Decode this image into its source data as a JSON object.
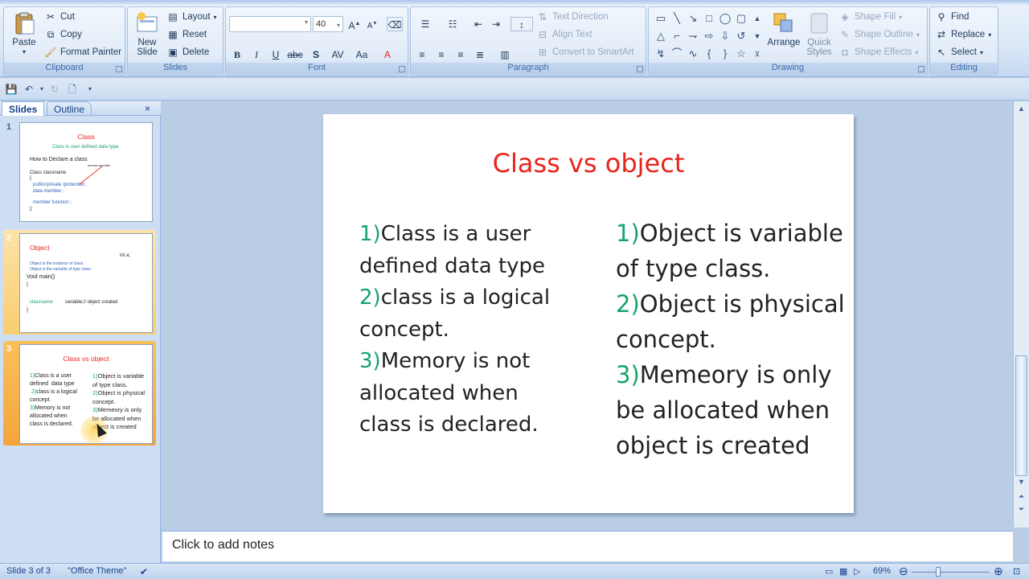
{
  "ribbon": {
    "clipboard": {
      "paste": "Paste",
      "cut": "Cut",
      "copy": "Copy",
      "format_painter": "Format Painter",
      "label": "Clipboard"
    },
    "slides": {
      "new_slide": "New Slide",
      "layout": "Layout",
      "reset": "Reset",
      "delete": "Delete",
      "label": "Slides"
    },
    "font": {
      "font_name": "",
      "font_size": "40",
      "label": "Font"
    },
    "paragraph": {
      "text_direction": "Text Direction",
      "align_text": "Align Text",
      "convert_smartart": "Convert to SmartArt",
      "label": "Paragraph"
    },
    "drawing": {
      "arrange": "Arrange",
      "quick_styles": "Quick Styles",
      "shape_fill": "Shape Fill",
      "shape_outline": "Shape Outline",
      "shape_effects": "Shape Effects",
      "label": "Drawing"
    },
    "editing": {
      "find": "Find",
      "replace": "Replace",
      "select": "Select",
      "label": "Editing"
    }
  },
  "pane": {
    "tabs": [
      {
        "label": "Slides"
      },
      {
        "label": "Outline"
      }
    ],
    "close": "×",
    "thumbs": [
      {
        "num": "1",
        "title": "Class",
        "lines": [
          "Class is user defined data type.",
          "How to Declare a class",
          "access specifier",
          "Class classname",
          "{",
          "public/private /protected :",
          "data member ;",
          "member function ;",
          "};"
        ]
      },
      {
        "num": "2",
        "title": "Object",
        "lines": [
          "int a;",
          "Object is the instance of class.",
          "Object is the variable of type class.",
          "Void main()",
          "{",
          "classname",
          "variable;// object created",
          "}"
        ]
      },
      {
        "num": "3",
        "title": "Class vs object",
        "left_lines": [
          "1)Class is a user",
          "defined  data type",
          " 2)class is a logical",
          "concept.",
          "3)Memory is not",
          "allocated when",
          "class is declared."
        ],
        "right_lines": [
          "1)Object is variable",
          "of type class.",
          "2)Object is physical",
          "concept.",
          "3)Memeory is only",
          "be allocated when",
          "object is created"
        ]
      }
    ]
  },
  "slide": {
    "title": "Class vs object",
    "left": [
      {
        "num": "1)",
        "text": "Class is a user"
      },
      {
        "num": "",
        "text": "defined  data type"
      },
      {
        "num": " 2)",
        "text": "class is a logical"
      },
      {
        "num": "",
        "text": "concept."
      },
      {
        "num": "3)",
        "text": "Memory is not"
      },
      {
        "num": "",
        "text": "allocated when"
      },
      {
        "num": "",
        "text": "class is declared."
      }
    ],
    "right": [
      {
        "num": "1)",
        "text": "Object is variable"
      },
      {
        "num": "",
        "text": "of type class."
      },
      {
        "num": "2)",
        "text": "Object is physical"
      },
      {
        "num": "",
        "text": "concept."
      },
      {
        "num": "3)",
        "text": "Memeory is only"
      },
      {
        "num": "",
        "text": "be allocated when"
      },
      {
        "num": "",
        "text": "object is created"
      }
    ]
  },
  "notes": {
    "placeholder": "Click to add notes"
  },
  "status": {
    "slide_info": "Slide 3 of 3",
    "theme": "\"Office Theme\"",
    "zoom": "69%"
  },
  "colors": {
    "title": "#e8241c",
    "numbering": "#16a36a",
    "ribbon_text": "#15428b"
  }
}
